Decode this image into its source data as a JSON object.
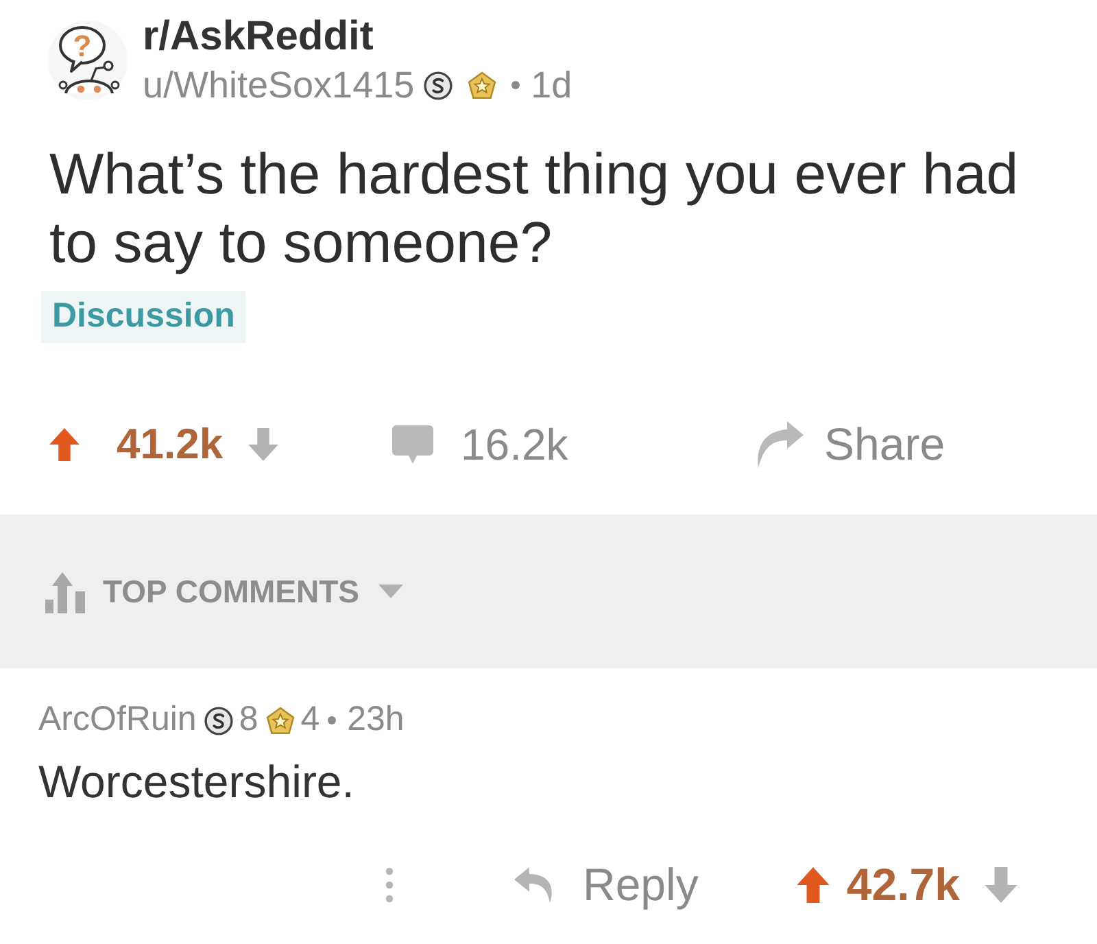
{
  "post_header": {
    "subreddit": "r/AskReddit",
    "avatar_glyph": "?",
    "author": "u/WhiteSox1415",
    "awards": [
      {
        "kind": "silver"
      },
      {
        "kind": "gold"
      }
    ],
    "age": "1d"
  },
  "post": {
    "title": "What’s the hardest thing you ever had to say to someone?",
    "flair": "Discussion",
    "score": "41.2k",
    "upvoted": true,
    "comments": "16.2k",
    "share": "Share"
  },
  "sort": {
    "label": "TOP COMMENTS"
  },
  "comments": [
    {
      "author": "ArcOfRuin",
      "awards": [
        {
          "kind": "silver",
          "count": "8"
        },
        {
          "kind": "gold",
          "count": "4"
        }
      ],
      "age": "23h",
      "body": "Worcestershire.",
      "reply": "Reply",
      "score": "42.7k",
      "upvoted": true
    }
  ]
}
